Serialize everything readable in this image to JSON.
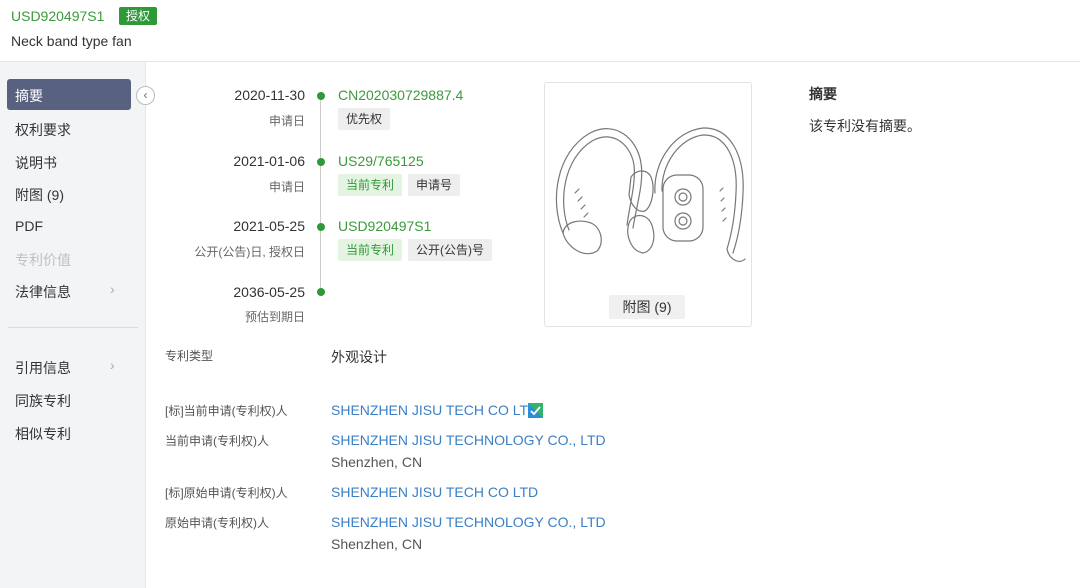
{
  "header": {
    "patent_number": "USD920497S1",
    "status_badge": "授权",
    "title": "Neck band type fan"
  },
  "sidebar": {
    "items": [
      {
        "label": "摘要",
        "state": "active"
      },
      {
        "label": "权利要求"
      },
      {
        "label": "说明书"
      },
      {
        "label": "附图 (9)"
      },
      {
        "label": "PDF"
      },
      {
        "label": "专利价值",
        "state": "disabled"
      },
      {
        "label": "法律信息",
        "chevron": "›"
      }
    ],
    "items2": [
      {
        "label": "引用信息",
        "chevron": "›"
      },
      {
        "label": "同族专利"
      },
      {
        "label": "相似专利"
      }
    ],
    "collapse_icon": "‹"
  },
  "timeline": [
    {
      "date": "2020-11-30",
      "label": "申请日",
      "link": "CN202030729887.4",
      "tags": [
        "优先权"
      ]
    },
    {
      "date": "2021-01-06",
      "label": "申请日",
      "link": "US29/765125",
      "tags": [
        "当前专利",
        "申请号"
      ]
    },
    {
      "date": "2021-05-25",
      "label": "公开(公告)日, 授权日",
      "link": "USD920497S1",
      "tags": [
        "当前专利",
        "公开(公告)号"
      ]
    },
    {
      "date": "2036-05-25",
      "label": "预估到期日"
    }
  ],
  "figure": {
    "button_label": "附图 (9)"
  },
  "abstract": {
    "title": "摘要",
    "text": "该专利没有摘要。"
  },
  "fields": {
    "patent_type": {
      "label": "专利类型",
      "value": "外观设计"
    },
    "std_current_applicant": {
      "label": "[标]当前申请(专利权)人",
      "value": "SHENZHEN JISU TECH CO LTD"
    },
    "current_applicant": {
      "label": "当前申请(专利权)人",
      "value": "SHENZHEN JISU TECHNOLOGY CO., LTD",
      "location": "Shenzhen, CN"
    },
    "std_original_applicant": {
      "label": "[标]原始申请(专利权)人",
      "value": "SHENZHEN JISU TECH CO LTD"
    },
    "original_applicant": {
      "label": "原始申请(专利权)人",
      "value": "SHENZHEN JISU TECHNOLOGY CO., LTD",
      "location": "Shenzhen, CN"
    }
  },
  "colors": {
    "accent_green": "#2e9a37",
    "link_blue": "#3b7fc4",
    "sidebar_active": "#596180"
  }
}
